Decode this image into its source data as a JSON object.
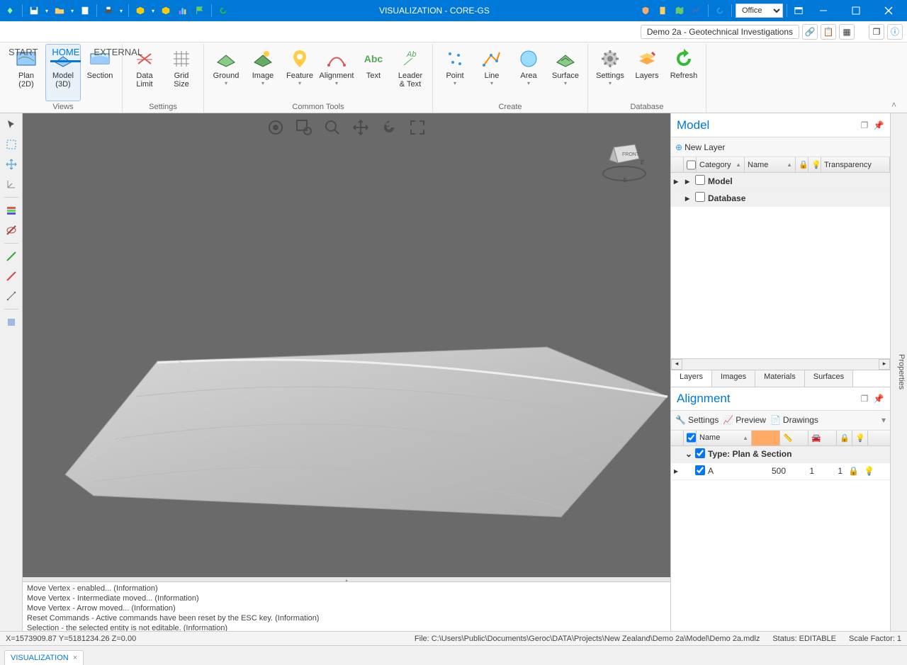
{
  "titlebar": {
    "title": "VISUALIZATION - CORE-GS",
    "theme": "Office"
  },
  "projectbar": {
    "project": "Demo 2a - Geotechnical Investigations"
  },
  "tabs": {
    "start": "START",
    "home": "HOME",
    "external": "EXTERNAL"
  },
  "ribbon": {
    "views": {
      "label": "Views",
      "plan2d": "Plan\n(2D)",
      "model3d": "Model\n(3D)",
      "section": "Section"
    },
    "settings": {
      "label": "Settings",
      "datalimit": "Data Limit",
      "gridsize": "Grid Size"
    },
    "common": {
      "label": "Common Tools",
      "ground": "Ground",
      "image": "Image",
      "feature": "Feature",
      "alignment": "Alignment",
      "text": "Text",
      "leader": "Leader\n& Text"
    },
    "create": {
      "label": "Create",
      "point": "Point",
      "line": "Line",
      "area": "Area",
      "surface": "Surface"
    },
    "database": {
      "label": "Database",
      "settings": "Settings",
      "layers": "Layers",
      "refresh": "Refresh"
    }
  },
  "modelpanel": {
    "title": "Model",
    "newlayer": "New Layer",
    "cols": {
      "category": "Category",
      "name": "Name",
      "transparency": "Transparency"
    },
    "rows": {
      "model": "Model",
      "database": "Database"
    },
    "tabs": {
      "layers": "Layers",
      "images": "Images",
      "materials": "Materials",
      "surfaces": "Surfaces"
    }
  },
  "alignpanel": {
    "title": "Alignment",
    "toolbar": {
      "settings": "Settings",
      "preview": "Preview",
      "drawings": "Drawings"
    },
    "cols": {
      "name": "Name"
    },
    "group": "Type: Plan & Section",
    "row": {
      "name": "A",
      "v1": "500",
      "v2": "1",
      "v3": "1"
    }
  },
  "proptab": "Properties",
  "log": {
    "l1": "Move Vertex - enabled... (Information)",
    "l2": "Move Vertex - Intermediate moved... (Information)",
    "l3": "Move Vertex - Arrow moved... (Information)",
    "l4": "Reset Commands - Active commands have been reset by the ESC key. (Information)",
    "l5": "Selection - the selected entity is not editable. (Information)"
  },
  "status": {
    "coords": "X=1573909.87   Y=5181234.26   Z=0.00",
    "file": "File: C:\\Users\\Public\\Documents\\Geroc\\DATA\\Projects\\New Zealand\\Demo 2a\\Model\\Demo 2a.mdlz",
    "state": "Status: EDITABLE",
    "scale": "Scale Factor: 1"
  },
  "doctab": "VISUALIZATION"
}
